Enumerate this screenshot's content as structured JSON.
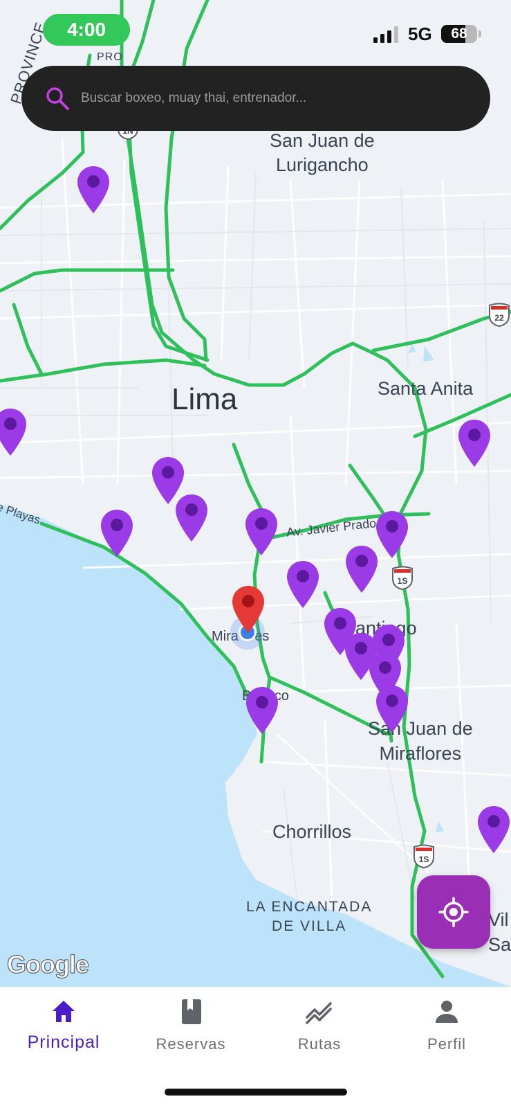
{
  "status_bar": {
    "time": "4:00",
    "network": "5G",
    "battery": "68",
    "battery_level": 0.68
  },
  "search": {
    "placeholder": "Buscar boxeo, muay thai, entrenador..."
  },
  "map": {
    "labels": {
      "city": "Lima",
      "san_juan_lurigancho": "San Juan de\nLurigancho",
      "santa_anita": "Santa Anita",
      "surco": "antiago\nco",
      "san_juan_miraflores": "San Juan de\nMiraflores",
      "chorrillos": "Chorrillos",
      "encantada": "LA ENCANTADA\nDE VILLA",
      "miraflores": "Mira   res",
      "barranco": "B    nco",
      "villa": "Vil\nSalv",
      "pro": "PRO",
      "province": "PROVINCE",
      "playas": "e Playas",
      "javier_prado": "Av. Javier Prado"
    },
    "shields": {
      "s1n": "1N",
      "s1s": "1S",
      "s22": "22"
    },
    "attribution": "Google"
  },
  "colors": {
    "accent": "#4b1dc9",
    "pin": "#9b3be8",
    "fab": "#9a2fb5",
    "water": "#bde3fa",
    "highway": "#2fbf5b"
  },
  "nav": [
    {
      "label": "Principal",
      "icon": "home-icon",
      "active": true
    },
    {
      "label": "Reservas",
      "icon": "book-icon",
      "active": false
    },
    {
      "label": "Rutas",
      "icon": "trending-icon",
      "active": false
    },
    {
      "label": "Perfil",
      "icon": "person-icon",
      "active": false
    }
  ]
}
